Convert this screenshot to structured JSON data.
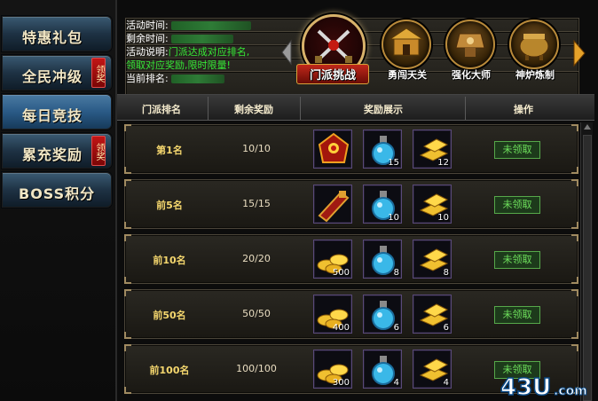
{
  "sidebar": {
    "items": [
      {
        "label": "特惠礼包",
        "badge": ""
      },
      {
        "label": "全民冲级",
        "badge": "领奖"
      },
      {
        "label": "每日竞技",
        "badge": ""
      },
      {
        "label": "累充奖励",
        "badge": "领奖"
      },
      {
        "label": "BOSS积分",
        "badge": ""
      }
    ]
  },
  "info": {
    "time_label": "活动时间:",
    "remain_label": "剩余时间:",
    "desc_label": "活动说明:",
    "desc_line1": "门派达成对应排名,",
    "desc_line2": "领取对应奖励,限时限量!",
    "rank_label": "当前排名:"
  },
  "carousel": {
    "categories": [
      "门派挑战",
      "勇闯天关",
      "强化大师",
      "神炉炼制"
    ]
  },
  "table": {
    "headers": [
      "门派排名",
      "剩余奖励",
      "奖励展示",
      "操作"
    ],
    "rows": [
      {
        "rank": "第1名",
        "remain": "10/10",
        "items": [
          {
            "icon": "red-gem-amulet",
            "qty": ""
          },
          {
            "icon": "blue-potion",
            "qty": "15"
          },
          {
            "icon": "gold-bar",
            "qty": "12"
          }
        ],
        "status": "未领取"
      },
      {
        "rank": "前5名",
        "remain": "15/15",
        "items": [
          {
            "icon": "red-gauntlet",
            "qty": ""
          },
          {
            "icon": "blue-potion",
            "qty": "10"
          },
          {
            "icon": "gold-bar",
            "qty": "10"
          }
        ],
        "status": "未领取"
      },
      {
        "rank": "前10名",
        "remain": "20/20",
        "items": [
          {
            "icon": "gold-ingots",
            "qty": "500"
          },
          {
            "icon": "blue-potion",
            "qty": "8"
          },
          {
            "icon": "gold-bar",
            "qty": "8"
          }
        ],
        "status": "未领取"
      },
      {
        "rank": "前50名",
        "remain": "50/50",
        "items": [
          {
            "icon": "gold-ingots",
            "qty": "400"
          },
          {
            "icon": "blue-potion",
            "qty": "6"
          },
          {
            "icon": "gold-bar",
            "qty": "6"
          }
        ],
        "status": "未领取"
      },
      {
        "rank": "前100名",
        "remain": "100/100",
        "items": [
          {
            "icon": "gold-ingots",
            "qty": "300"
          },
          {
            "icon": "blue-potion",
            "qty": "4"
          },
          {
            "icon": "gold-bar",
            "qty": "4"
          }
        ],
        "status": "未领取"
      }
    ]
  },
  "watermark": {
    "text": "43U",
    "suffix": ".com"
  },
  "colors": {
    "gold": "#f5d76e",
    "green": "#6ee05c",
    "accent_red": "#c0281a"
  }
}
